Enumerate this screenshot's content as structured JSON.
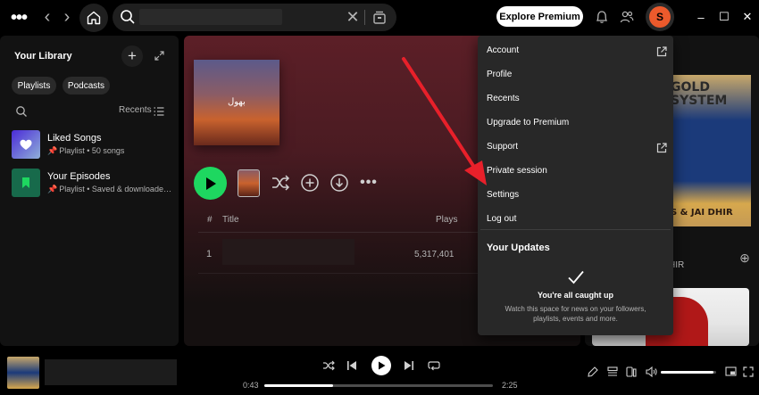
{
  "topbar": {
    "explore_label": "Explore Premium",
    "avatar_initial": "S"
  },
  "library": {
    "title": "Your Library",
    "chips": [
      "Playlists",
      "Podcasts"
    ],
    "sort_label": "Recents",
    "items": [
      {
        "name": "Liked Songs",
        "type": "Playlist",
        "detail": "50 songs"
      },
      {
        "name": "Your Episodes",
        "type": "Playlist",
        "detail": "Saved & downloaded episodes"
      }
    ]
  },
  "main": {
    "cover_text": "بھول",
    "columns": {
      "hash": "#",
      "title": "Title",
      "plays": "Plays"
    },
    "rows": [
      {
        "num": "1",
        "plays": "5,317,401"
      }
    ]
  },
  "right_panel": {
    "album_title_line1": "GOLD",
    "album_title_line2": "SYSTEM",
    "album_sub": "S & JAI DHIR",
    "section_partial": "HIR"
  },
  "menu": {
    "items": [
      {
        "label": "Account",
        "external": true
      },
      {
        "label": "Profile",
        "external": false
      },
      {
        "label": "Recents",
        "external": false
      },
      {
        "label": "Upgrade to Premium",
        "external": false
      },
      {
        "label": "Support",
        "external": true
      },
      {
        "label": "Private session",
        "external": false
      },
      {
        "label": "Settings",
        "external": false
      },
      {
        "label": "Log out",
        "external": false
      }
    ],
    "updates_title": "Your Updates",
    "caught_up": "You're all caught up",
    "watch_text": "Watch this space for news on your followers, playlists, events and more."
  },
  "player": {
    "time_elapsed": "0:43",
    "time_total": "2:25",
    "progress": 0.3,
    "volume": 0.95
  },
  "colors": {
    "accent": "#1ed760",
    "avatar": "#ec5a2c",
    "arrow": "#e8202a"
  }
}
